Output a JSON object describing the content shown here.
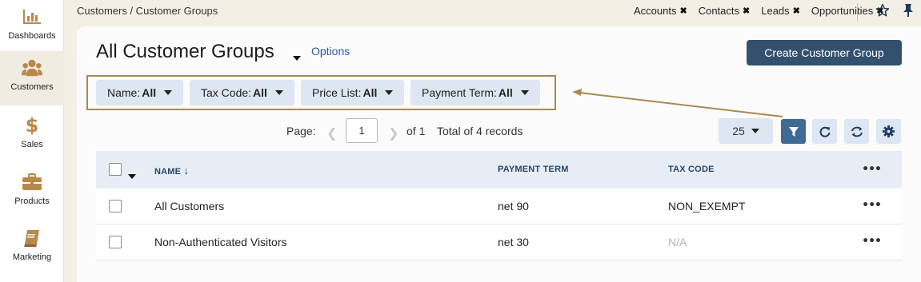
{
  "sidebar": {
    "items": [
      {
        "label": "Dashboards",
        "icon": "bar-chart-icon"
      },
      {
        "label": "Customers",
        "icon": "users-icon"
      },
      {
        "label": "Sales",
        "icon": "dollar-icon"
      },
      {
        "label": "Products",
        "icon": "briefcase-icon"
      },
      {
        "label": "Marketing",
        "icon": "book-icon"
      }
    ]
  },
  "topbar": {
    "breadcrumb": "Customers / Customer Groups",
    "quick_tabs": [
      "Accounts",
      "Contacts",
      "Leads",
      "Opportunities"
    ],
    "close_glyph": "✖"
  },
  "header": {
    "title": "All Customer Groups",
    "options_label": "Options",
    "create_label": "Create Customer Group"
  },
  "filters": [
    {
      "label": "Name:",
      "value": "All"
    },
    {
      "label": "Tax Code:",
      "value": "All"
    },
    {
      "label": "Price List:",
      "value": "All"
    },
    {
      "label": "Payment Term:",
      "value": "All"
    }
  ],
  "pagination": {
    "page_label": "Page:",
    "page_value": "1",
    "of_label": "of 1",
    "total_label": "Total of 4 records",
    "per_page": "25"
  },
  "table": {
    "columns": [
      "NAME",
      "PAYMENT TERM",
      "TAX CODE"
    ],
    "rows": [
      {
        "name": "All Customers",
        "payment_term": "net 90",
        "tax_code": "NON_EXEMPT"
      },
      {
        "name": "Non-Authenticated Visitors",
        "payment_term": "net 30",
        "tax_code": "N/A"
      }
    ]
  },
  "colors": {
    "accent": "#34506f",
    "filter_bg": "#dde6f2",
    "annotation": "#a88a52",
    "nav_icon": "#b8894a"
  }
}
